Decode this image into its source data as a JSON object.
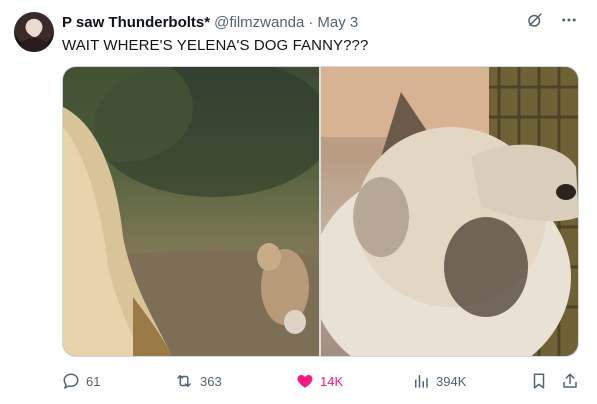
{
  "tweet": {
    "author_name": "P saw Thunderbolts*",
    "handle": "@filmzwanda",
    "separator": "·",
    "date": "May 3",
    "text": "WAIT WHERE'S YELENA'S DOG FANNY???"
  },
  "media": {
    "count": 2
  },
  "actions": {
    "replies": "61",
    "reposts": "363",
    "likes": "14K",
    "liked": true,
    "views": "394K"
  },
  "colors": {
    "text_primary": "#0f1419",
    "text_secondary": "#536471",
    "like_active": "#f91880",
    "border": "#cfd9de"
  },
  "icons": {
    "grok": "grok-icon",
    "more": "more-icon",
    "reply": "reply-icon",
    "repost": "repost-icon",
    "like": "heart-icon",
    "views": "views-icon",
    "bookmark": "bookmark-icon",
    "share": "share-icon"
  }
}
